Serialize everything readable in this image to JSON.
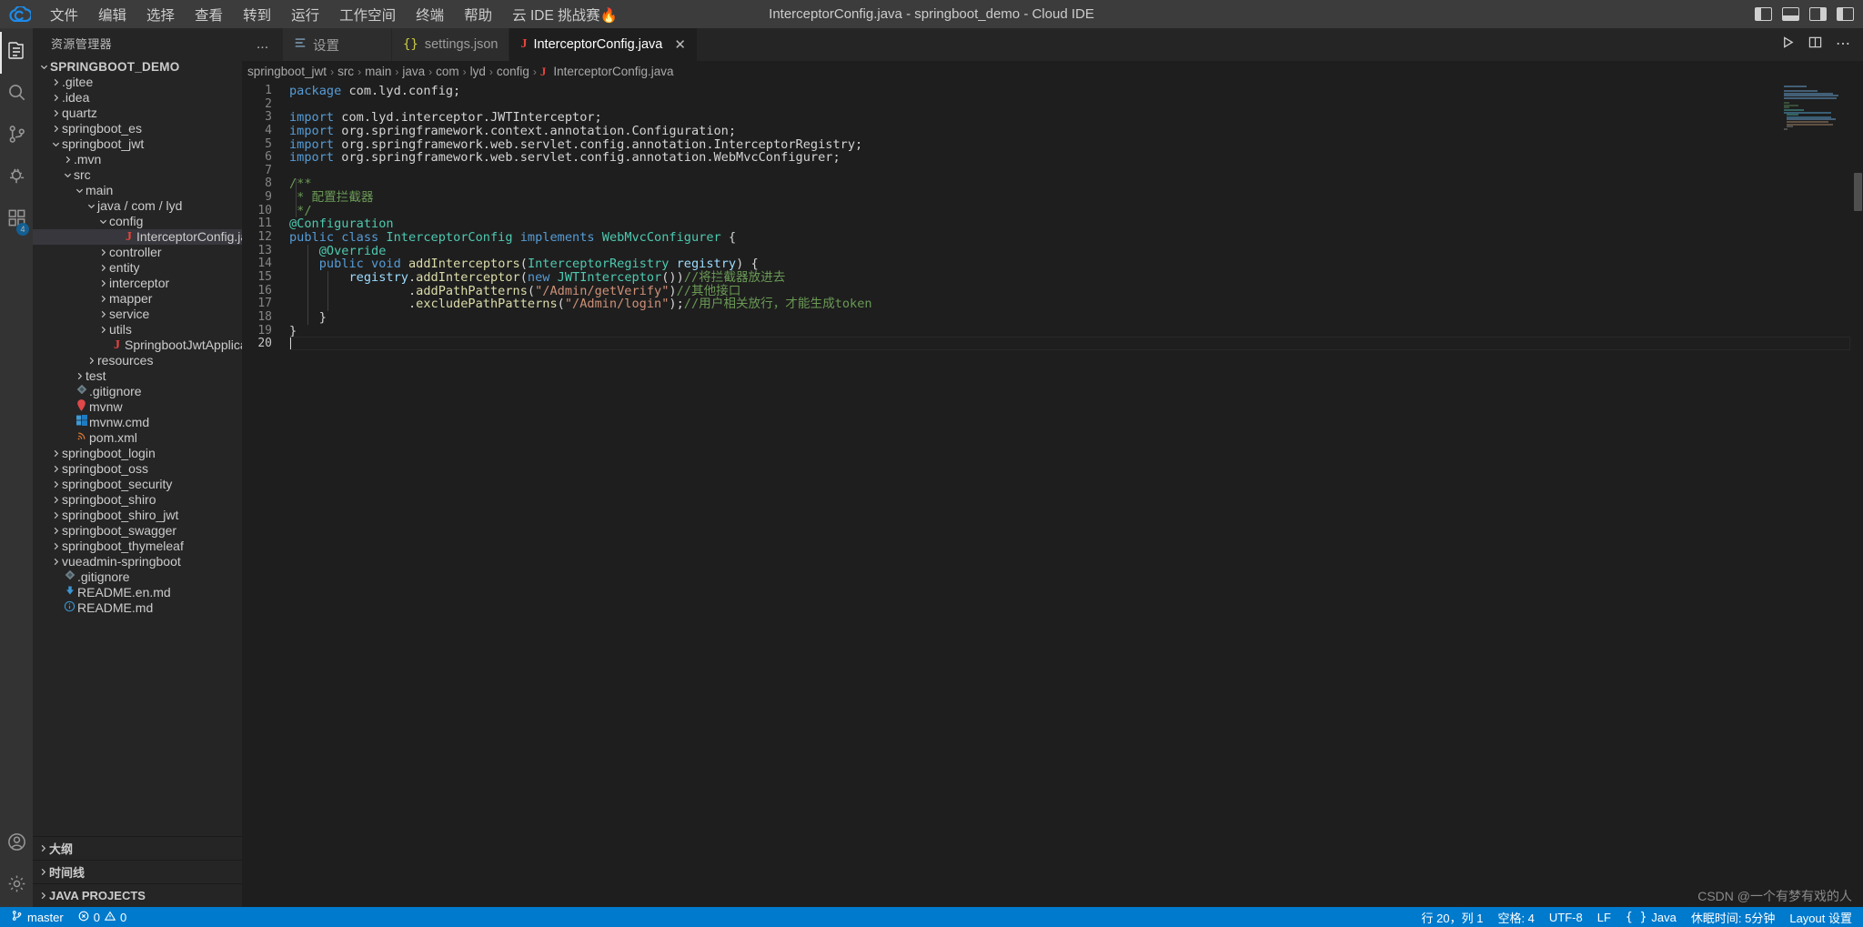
{
  "titlebar": {
    "logo_icon": "cloud-logo-icon",
    "window_title": "InterceptorConfig.java - springboot_demo - Cloud IDE",
    "menus": [
      {
        "label": "文件"
      },
      {
        "label": "编辑"
      },
      {
        "label": "选择"
      },
      {
        "label": "查看"
      },
      {
        "label": "转到"
      },
      {
        "label": "运行"
      },
      {
        "label": "工作空间"
      },
      {
        "label": "终端"
      },
      {
        "label": "帮助"
      },
      {
        "label": "云 IDE 挑战赛🔥"
      }
    ],
    "controls": [
      {
        "name": "toggle-primary-sidebar-icon"
      },
      {
        "name": "toggle-panel-icon"
      },
      {
        "name": "toggle-secondary-sidebar-icon"
      },
      {
        "name": "customize-layout-icon"
      }
    ]
  },
  "activitybar": {
    "items": [
      {
        "name": "explorer",
        "icon": "files-icon",
        "active": true,
        "badge": ""
      },
      {
        "name": "search",
        "icon": "search-icon",
        "active": false,
        "badge": ""
      },
      {
        "name": "source-control",
        "icon": "source-control-icon",
        "active": false,
        "badge": ""
      },
      {
        "name": "run-and-debug",
        "icon": "debug-icon",
        "active": false,
        "badge": ""
      },
      {
        "name": "extensions",
        "icon": "extensions-icon",
        "active": false,
        "badge": "4"
      }
    ],
    "bottom": [
      {
        "name": "accounts",
        "icon": "account-icon"
      },
      {
        "name": "manage",
        "icon": "gear-icon"
      }
    ]
  },
  "sidebar": {
    "title": "资源管理器",
    "more_actions": "...",
    "tree": [
      {
        "label": "SPRINGBOOT_DEMO",
        "indent": 0,
        "twisty": "down",
        "icon": "",
        "root": true
      },
      {
        "label": ".gitee",
        "indent": 1,
        "twisty": "right",
        "icon": ""
      },
      {
        "label": ".idea",
        "indent": 1,
        "twisty": "right",
        "icon": ""
      },
      {
        "label": "quartz",
        "indent": 1,
        "twisty": "right",
        "icon": ""
      },
      {
        "label": "springboot_es",
        "indent": 1,
        "twisty": "right",
        "icon": ""
      },
      {
        "label": "springboot_jwt",
        "indent": 1,
        "twisty": "down",
        "icon": ""
      },
      {
        "label": ".mvn",
        "indent": 2,
        "twisty": "right",
        "icon": ""
      },
      {
        "label": "src",
        "indent": 2,
        "twisty": "down",
        "icon": ""
      },
      {
        "label": "main",
        "indent": 3,
        "twisty": "down",
        "icon": ""
      },
      {
        "label": "java / com / lyd",
        "indent": 4,
        "twisty": "down",
        "icon": ""
      },
      {
        "label": "config",
        "indent": 5,
        "twisty": "down",
        "icon": ""
      },
      {
        "label": "InterceptorConfig.java",
        "indent": 6,
        "twisty": "none",
        "icon": "java-file-icon",
        "selected": true
      },
      {
        "label": "controller",
        "indent": 5,
        "twisty": "right",
        "icon": ""
      },
      {
        "label": "entity",
        "indent": 5,
        "twisty": "right",
        "icon": ""
      },
      {
        "label": "interceptor",
        "indent": 5,
        "twisty": "right",
        "icon": ""
      },
      {
        "label": "mapper",
        "indent": 5,
        "twisty": "right",
        "icon": ""
      },
      {
        "label": "service",
        "indent": 5,
        "twisty": "right",
        "icon": ""
      },
      {
        "label": "utils",
        "indent": 5,
        "twisty": "right",
        "icon": ""
      },
      {
        "label": "SpringbootJwtApplication.java",
        "indent": 5,
        "twisty": "none",
        "icon": "java-file-icon"
      },
      {
        "label": "resources",
        "indent": 4,
        "twisty": "right",
        "icon": ""
      },
      {
        "label": "test",
        "indent": 3,
        "twisty": "right",
        "icon": ""
      },
      {
        "label": ".gitignore",
        "indent": 2,
        "twisty": "none",
        "icon": "git-file-icon"
      },
      {
        "label": "mvnw",
        "indent": 2,
        "twisty": "none",
        "icon": "maven-file-icon"
      },
      {
        "label": "mvnw.cmd",
        "indent": 2,
        "twisty": "none",
        "icon": "windows-file-icon"
      },
      {
        "label": "pom.xml",
        "indent": 2,
        "twisty": "none",
        "icon": "xml-file-icon"
      },
      {
        "label": "springboot_login",
        "indent": 1,
        "twisty": "right",
        "icon": ""
      },
      {
        "label": "springboot_oss",
        "indent": 1,
        "twisty": "right",
        "icon": ""
      },
      {
        "label": "springboot_security",
        "indent": 1,
        "twisty": "right",
        "icon": ""
      },
      {
        "label": "springboot_shiro",
        "indent": 1,
        "twisty": "right",
        "icon": ""
      },
      {
        "label": "springboot_shiro_jwt",
        "indent": 1,
        "twisty": "right",
        "icon": ""
      },
      {
        "label": "springboot_swagger",
        "indent": 1,
        "twisty": "right",
        "icon": ""
      },
      {
        "label": "springboot_thymeleaf",
        "indent": 1,
        "twisty": "right",
        "icon": ""
      },
      {
        "label": "vueadmin-springboot",
        "indent": 1,
        "twisty": "right",
        "icon": ""
      },
      {
        "label": ".gitignore",
        "indent": 1,
        "twisty": "none",
        "icon": "git-file-icon"
      },
      {
        "label": "README.en.md",
        "indent": 1,
        "twisty": "none",
        "icon": "markdown-file-icon"
      },
      {
        "label": "README.md",
        "indent": 1,
        "twisty": "none",
        "icon": "info-file-icon"
      }
    ],
    "sections": [
      {
        "label": "大纲",
        "twisty": "right"
      },
      {
        "label": "时间线",
        "twisty": "right"
      },
      {
        "label": "JAVA PROJECTS",
        "twisty": "right"
      }
    ]
  },
  "editor": {
    "tabs": [
      {
        "label": "设置",
        "icon": "settings-tab-icon",
        "active": false,
        "closable": false
      },
      {
        "label": "settings.json",
        "icon": "json-file-icon",
        "active": false,
        "closable": false
      },
      {
        "label": "InterceptorConfig.java",
        "icon": "java-file-icon",
        "active": true,
        "closable": true
      }
    ],
    "tab_close_label": "✕",
    "actions": [
      {
        "name": "run-button",
        "icon": "play-icon"
      },
      {
        "name": "split-editor-button",
        "icon": "split-icon"
      },
      {
        "name": "more-actions-button",
        "icon": "ellipsis-icon"
      }
    ],
    "breadcrumb": [
      "springboot_jwt",
      "src",
      "main",
      "java",
      "com",
      "lyd",
      "config",
      "InterceptorConfig.java"
    ],
    "breadcrumb_separator": "›",
    "breadcrumb_file_icon": "java-file-icon",
    "code_lines": [
      {
        "n": 1,
        "tokens": [
          {
            "t": "package ",
            "c": "kw"
          },
          {
            "t": "com.lyd.config;",
            "c": ""
          }
        ]
      },
      {
        "n": 2,
        "tokens": []
      },
      {
        "n": 3,
        "tokens": [
          {
            "t": "import ",
            "c": "kw"
          },
          {
            "t": "com.lyd.interceptor.JWTInterceptor;",
            "c": ""
          }
        ]
      },
      {
        "n": 4,
        "tokens": [
          {
            "t": "import ",
            "c": "kw"
          },
          {
            "t": "org.springframework.context.annotation.Configuration;",
            "c": ""
          }
        ]
      },
      {
        "n": 5,
        "tokens": [
          {
            "t": "import ",
            "c": "kw"
          },
          {
            "t": "org.springframework.web.servlet.config.annotation.InterceptorRegistry;",
            "c": ""
          }
        ]
      },
      {
        "n": 6,
        "tokens": [
          {
            "t": "import ",
            "c": "kw"
          },
          {
            "t": "org.springframework.web.servlet.config.annotation.WebMvcConfigurer;",
            "c": ""
          }
        ]
      },
      {
        "n": 7,
        "tokens": []
      },
      {
        "n": 8,
        "tokens": [
          {
            "t": "/**",
            "c": "cmt"
          }
        ]
      },
      {
        "n": 9,
        "tokens": [
          {
            "t": " * 配置拦截器",
            "c": "cmt"
          }
        ]
      },
      {
        "n": 10,
        "tokens": [
          {
            "t": " */",
            "c": "cmt"
          }
        ]
      },
      {
        "n": 11,
        "tokens": [
          {
            "t": "@Configuration",
            "c": "typ"
          }
        ]
      },
      {
        "n": 12,
        "tokens": [
          {
            "t": "public ",
            "c": "kw"
          },
          {
            "t": "class ",
            "c": "kw"
          },
          {
            "t": "InterceptorConfig",
            "c": "typ"
          },
          {
            "t": " ",
            "c": ""
          },
          {
            "t": "implements",
            "c": "kw"
          },
          {
            "t": " ",
            "c": ""
          },
          {
            "t": "WebMvcConfigurer",
            "c": "typ"
          },
          {
            "t": " {",
            "c": ""
          }
        ]
      },
      {
        "n": 13,
        "tokens": [
          {
            "t": "    ",
            "c": ""
          },
          {
            "t": "@Override",
            "c": "typ"
          }
        ]
      },
      {
        "n": 14,
        "tokens": [
          {
            "t": "    ",
            "c": ""
          },
          {
            "t": "public ",
            "c": "kw"
          },
          {
            "t": "void",
            "c": "kw"
          },
          {
            "t": " ",
            "c": ""
          },
          {
            "t": "addInterceptors",
            "c": "fn"
          },
          {
            "t": "(",
            "c": ""
          },
          {
            "t": "InterceptorRegistry",
            "c": "typ"
          },
          {
            "t": " ",
            "c": ""
          },
          {
            "t": "registry",
            "c": "var"
          },
          {
            "t": ") {",
            "c": ""
          }
        ]
      },
      {
        "n": 15,
        "tokens": [
          {
            "t": "        ",
            "c": ""
          },
          {
            "t": "registry",
            "c": "var"
          },
          {
            "t": ".",
            "c": ""
          },
          {
            "t": "addInterceptor",
            "c": "fn"
          },
          {
            "t": "(",
            "c": ""
          },
          {
            "t": "new ",
            "c": "kw"
          },
          {
            "t": "JWTInterceptor",
            "c": "typ"
          },
          {
            "t": "())",
            "c": ""
          },
          {
            "t": "//将拦截器放进去",
            "c": "cmt"
          }
        ]
      },
      {
        "n": 16,
        "tokens": [
          {
            "t": "                .",
            "c": ""
          },
          {
            "t": "addPathPatterns",
            "c": "fn"
          },
          {
            "t": "(",
            "c": ""
          },
          {
            "t": "\"/Admin/getVerify\"",
            "c": "str"
          },
          {
            "t": ")",
            "c": ""
          },
          {
            "t": "//其他接口",
            "c": "cmt"
          }
        ]
      },
      {
        "n": 17,
        "tokens": [
          {
            "t": "                .",
            "c": ""
          },
          {
            "t": "excludePathPatterns",
            "c": "fn"
          },
          {
            "t": "(",
            "c": ""
          },
          {
            "t": "\"/Admin/login\"",
            "c": "str"
          },
          {
            "t": ");",
            "c": ""
          },
          {
            "t": "//用户相关放行，才能生成token",
            "c": "cmt"
          }
        ]
      },
      {
        "n": 18,
        "tokens": [
          {
            "t": "    }",
            "c": ""
          }
        ]
      },
      {
        "n": 19,
        "tokens": [
          {
            "t": "}",
            "c": ""
          }
        ]
      },
      {
        "n": 20,
        "tokens": [],
        "cursor": true
      }
    ]
  },
  "statusbar": {
    "left": [
      {
        "name": "branch",
        "icon": "source-control-icon",
        "label": "master"
      },
      {
        "name": "problems",
        "icon": "error-warning-icon",
        "label": "0 ⚠ 0",
        "errors": "0",
        "warnings": "0"
      }
    ],
    "right": [
      {
        "name": "cursor-position",
        "label": "行 20，列 1"
      },
      {
        "name": "indentation",
        "label": "空格: 4"
      },
      {
        "name": "encoding",
        "label": "UTF-8"
      },
      {
        "name": "eol",
        "label": "LF"
      },
      {
        "name": "language-mode",
        "label": "Java",
        "icon": "braces-icon"
      },
      {
        "name": "hibernate-time",
        "label": "休眠时间: 5分钟"
      },
      {
        "name": "layout",
        "label": "Layout 设置"
      }
    ]
  },
  "watermark": "CSDN @一个有梦有戏的人",
  "colors": {
    "accent": "#007acc",
    "titlebar_bg": "#3c3c3c",
    "sidebar_bg": "#252526",
    "editor_bg": "#1e1e1e",
    "activitybar_bg": "#333333",
    "selection_bg": "#37373d",
    "keyword": "#569cd6",
    "type": "#4ec9b0",
    "function": "#dcdcaa",
    "string": "#ce9178",
    "comment": "#6a9955",
    "variable": "#9cdcfe",
    "java_icon": "#e8443a"
  }
}
